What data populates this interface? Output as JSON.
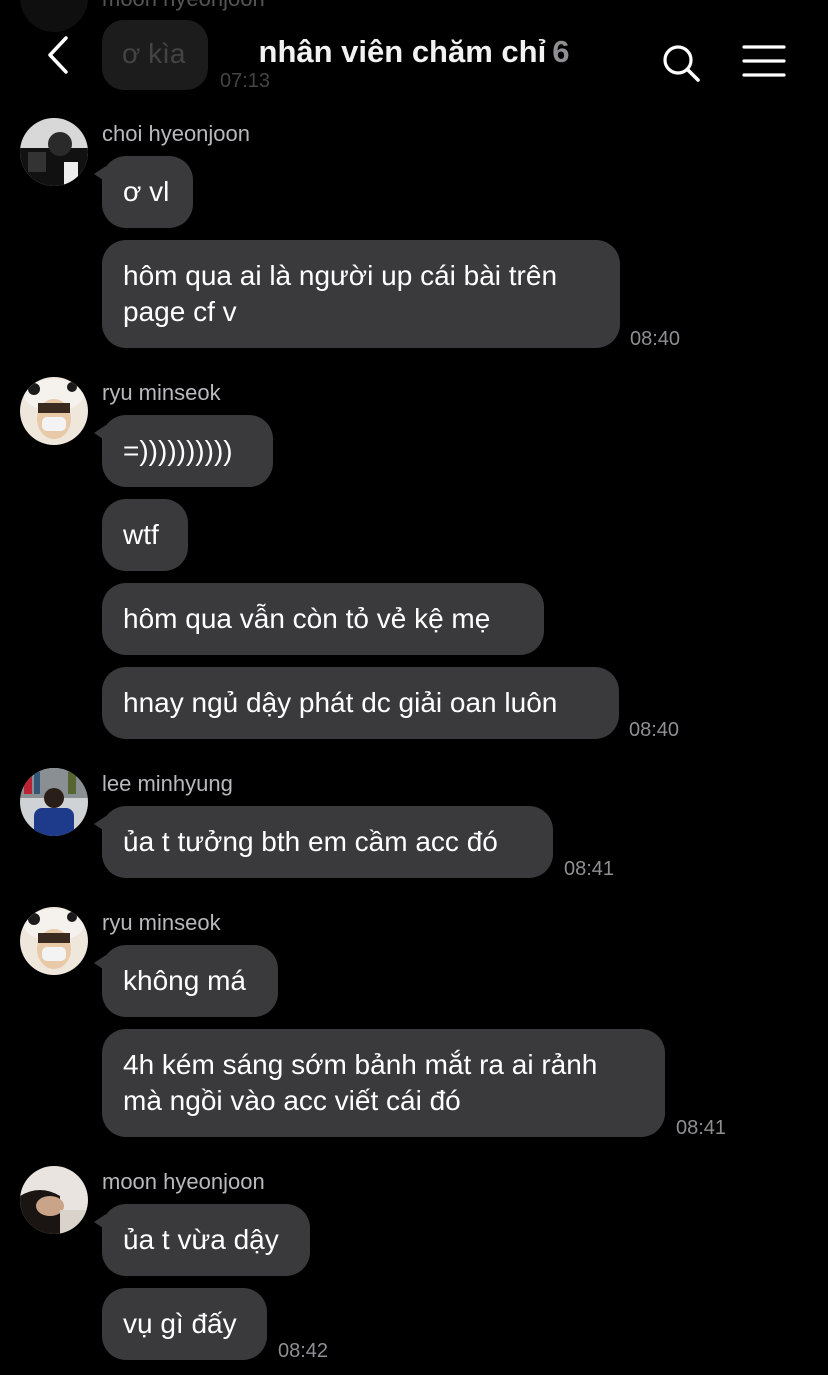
{
  "header": {
    "title": "nhân viên chăm chỉ",
    "member_count": "6"
  },
  "ghost": {
    "name": "moon hyeonjoon",
    "text": "ơ kìa",
    "time": "07:13"
  },
  "messages": [
    {
      "sender": "choi hyeonjoon",
      "bubbles": [
        "ơ vl",
        "hôm qua ai là người up cái bài trên page cf v"
      ],
      "time": "08:40"
    },
    {
      "sender": "ryu minseok",
      "bubbles": [
        "=))))))))))",
        "wtf",
        "hôm qua vẫn còn tỏ vẻ kệ mẹ",
        "hnay ngủ dậy phát dc giải oan luôn"
      ],
      "time": "08:40"
    },
    {
      "sender": "lee minhyung",
      "bubbles": [
        "ủa t tưởng bth em cầm acc đó"
      ],
      "time": "08:41"
    },
    {
      "sender": "ryu minseok",
      "bubbles": [
        "không má",
        "4h kém sáng sớm bảnh mắt ra ai rảnh mà ngồi vào acc viết cái đó"
      ],
      "time": "08:41"
    },
    {
      "sender": "moon hyeonjoon",
      "bubbles": [
        "ủa t vừa dậy",
        "vụ gì đấy"
      ],
      "time": "08:42"
    }
  ]
}
